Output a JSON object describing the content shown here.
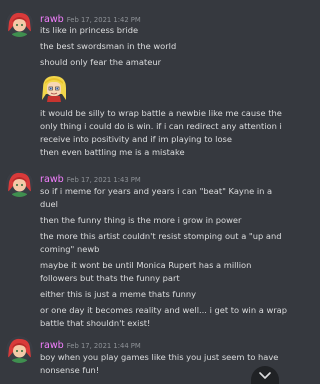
{
  "theme": {
    "background": "#36393f",
    "username_color": "#f47fff",
    "text_color": "#dcddde",
    "timestamp_color": "#8e9297"
  },
  "messages": [
    {
      "author": "rawb",
      "timestamp": "Feb 17, 2021 1:42 PM",
      "lines_before_emote": [
        "its like in princess bride",
        "the best swordsman in the world",
        "should only fear the amateur"
      ],
      "emote": "blonde-character-emote",
      "lines_after_emote": [
        "it would be silly to wrap battle a newbie like me cause the",
        "only thing i could do is win. if i can redirect any attention i",
        "receive into positivity and if im playing to lose",
        "then even battling me is a mistake"
      ]
    },
    {
      "author": "rawb",
      "timestamp": "Feb 17, 2021 1:43 PM",
      "lines": [
        "so if i meme for years and years i can \"beat\" Kayne in a",
        "duel",
        "then the funny thing is the more i grow in power",
        "the more this artist couldn't resist stomping out a \"up and",
        "coming\" newb",
        "maybe it wont be until Monica Rupert has a million",
        "followers but thats the funny part",
        "either this is just a meme thats funny",
        "or one day it becomes reality and well... i get to win a wrap",
        "battle that shouldn't exist!"
      ]
    },
    {
      "author": "rawb",
      "timestamp": "Feb 17, 2021 1:44 PM",
      "lines": [
        "boy when you play games like this you just seem to have",
        "nonsense fun!"
      ]
    }
  ],
  "scroll_button": {
    "icon": "chevron-down-icon"
  }
}
